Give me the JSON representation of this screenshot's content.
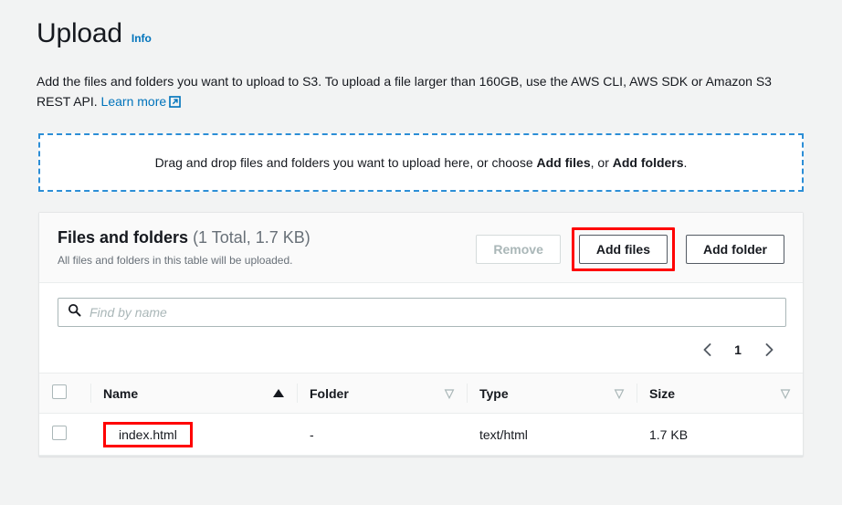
{
  "header": {
    "title": "Upload",
    "info_label": "Info",
    "description_part1": "Add the files and folders you want to upload to S3. To upload a file larger than 160GB, use the AWS CLI, AWS SDK or Amazon S3 REST API. ",
    "learn_more_label": "Learn more",
    "external_link_icon": "external-link-icon"
  },
  "dropzone": {
    "text_part1": "Drag and drop files and folders you want to upload here, or choose ",
    "bold1": "Add files",
    "text_part2": ", or ",
    "bold2": "Add folders",
    "text_part3": "."
  },
  "card": {
    "heading": "Files and folders",
    "count": "(1 Total, 1.7 KB)",
    "subheading": "All files and folders in this table will be uploaded.",
    "buttons": {
      "remove": "Remove",
      "add_files": "Add files",
      "add_folder": "Add folder"
    }
  },
  "filter": {
    "placeholder": "Find by name",
    "value": "",
    "icon": "search-icon"
  },
  "pagination": {
    "prev_icon": "chevron-left-icon",
    "next_icon": "chevron-right-icon",
    "current_page": "1"
  },
  "table": {
    "columns": [
      {
        "label": "Name",
        "sort": "asc"
      },
      {
        "label": "Folder",
        "sort": "none"
      },
      {
        "label": "Type",
        "sort": "none"
      },
      {
        "label": "Size",
        "sort": "none"
      }
    ],
    "rows": [
      {
        "name": "index.html",
        "folder": "-",
        "type": "text/html",
        "size": "1.7 KB"
      }
    ]
  },
  "colors": {
    "accent_blue": "#0073bb",
    "dropzone_border": "#2c8ed6",
    "highlight_red": "#ff0000",
    "page_bg": "#f2f3f3",
    "card_header_bg": "#fafafa"
  }
}
